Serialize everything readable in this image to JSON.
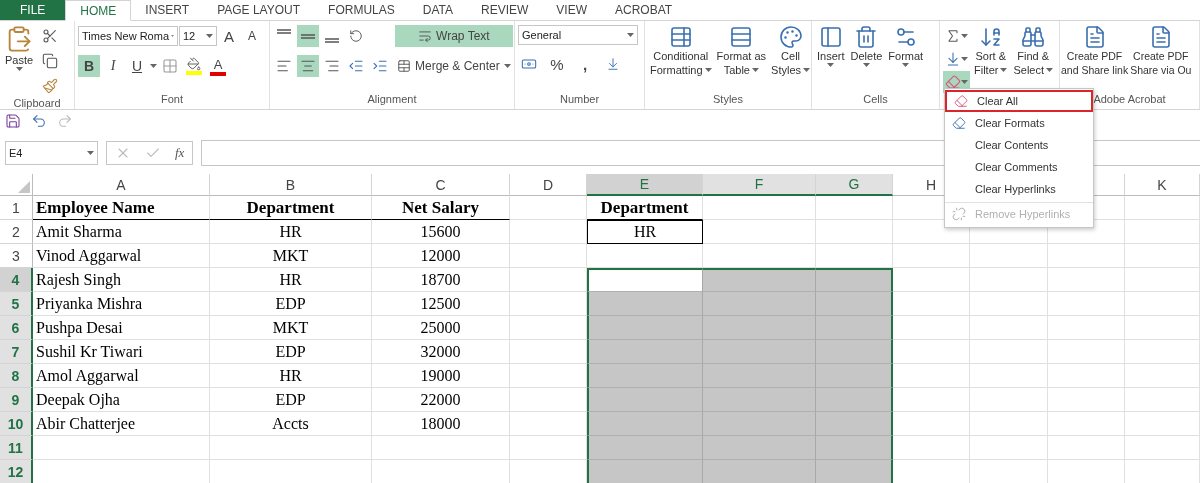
{
  "tabs": [
    {
      "label": "FILE",
      "kind": "file",
      "selected": false
    },
    {
      "label": "HOME",
      "kind": "tab",
      "selected": true
    },
    {
      "label": "INSERT",
      "kind": "tab",
      "selected": false
    },
    {
      "label": "PAGE LAYOUT",
      "kind": "tab",
      "selected": false
    },
    {
      "label": "FORMULAS",
      "kind": "tab",
      "selected": false
    },
    {
      "label": "DATA",
      "kind": "tab",
      "selected": false
    },
    {
      "label": "REVIEW",
      "kind": "tab",
      "selected": false
    },
    {
      "label": "VIEW",
      "kind": "tab",
      "selected": false
    },
    {
      "label": "ACROBAT",
      "kind": "tab",
      "selected": false
    }
  ],
  "clipboard": {
    "label": "Clipboard",
    "paste": "Paste"
  },
  "font": {
    "label": "Font",
    "font_name": "Times New Roma",
    "font_size": "12",
    "grow": "A",
    "shrink": "A",
    "bold": {
      "label": "B",
      "selected": true
    },
    "italic": {
      "label": "I",
      "selected": false
    },
    "underline": {
      "label": "U",
      "selected": false
    },
    "font_color": "A"
  },
  "alignment": {
    "label": "Alignment",
    "vertical": [
      {
        "selected": false
      },
      {
        "selected": true
      },
      {
        "selected": false
      }
    ],
    "horizontal": [
      {
        "selected": false
      },
      {
        "selected": true
      },
      {
        "selected": false
      }
    ],
    "wrap_text": {
      "label": "Wrap Text",
      "selected": true
    },
    "merge": "Merge & Center"
  },
  "number": {
    "label": "Number",
    "format": "General",
    "percent": "%",
    "comma": ","
  },
  "styles": {
    "label": "Styles",
    "buttons": [
      {
        "lines": [
          "Conditional",
          "Formatting"
        ]
      },
      {
        "lines": [
          "Format as",
          "Table"
        ]
      },
      {
        "lines": [
          "Cell",
          "Styles"
        ]
      }
    ]
  },
  "cells": {
    "label": "Cells",
    "buttons": [
      "Insert",
      "Delete",
      "Format"
    ]
  },
  "editing": {
    "clear_pressed": true,
    "buttons": [
      {
        "lines": [
          "Sort &",
          "Filter"
        ]
      },
      {
        "lines": [
          "Find &",
          "Select"
        ]
      }
    ]
  },
  "acrobat": {
    "label": "Adobe Acrobat",
    "buttons": [
      {
        "lines": [
          "Create PDF",
          "and Share link"
        ]
      },
      {
        "lines": [
          "Create PDF",
          "Share via Ou"
        ]
      }
    ]
  },
  "formula_bar": {
    "name_box": "E4",
    "function_label": "fx"
  },
  "columns": [
    {
      "label": "A",
      "selected": false,
      "active": false
    },
    {
      "label": "B",
      "selected": false,
      "active": false
    },
    {
      "label": "C",
      "selected": false,
      "active": false
    },
    {
      "label": "D",
      "selected": false,
      "active": false
    },
    {
      "label": "E",
      "selected": true,
      "active": true
    },
    {
      "label": "F",
      "selected": true,
      "active": false
    },
    {
      "label": "G",
      "selected": true,
      "active": false
    },
    {
      "label": "H",
      "selected": false,
      "active": false
    },
    {
      "label": "K",
      "selected": false,
      "active": false
    }
  ],
  "rows": [
    {
      "number": "1",
      "selected": false,
      "active": false,
      "cells": [
        {
          "text": "Employee Name",
          "kind": "heading"
        },
        {
          "text": "Department",
          "kind": "heading"
        },
        {
          "text": "Net Salary",
          "kind": "heading"
        },
        null,
        {
          "text": "Department",
          "kind": "heading"
        },
        null,
        null,
        null,
        null
      ]
    },
    {
      "number": "2",
      "selected": false,
      "active": false,
      "cells": [
        {
          "text": "Amit Sharma",
          "kind": "plain"
        },
        {
          "text": "HR",
          "kind": "plain"
        },
        {
          "text": "15600",
          "kind": "plain"
        },
        null,
        {
          "text": "HR",
          "kind": "boxed"
        },
        null,
        null,
        null,
        null
      ]
    },
    {
      "number": "3",
      "selected": false,
      "active": false,
      "cells": [
        {
          "text": "Vinod Aggarwal",
          "kind": "plain"
        },
        {
          "text": "MKT",
          "kind": "plain"
        },
        {
          "text": "12000",
          "kind": "plain"
        },
        null,
        null,
        null,
        null,
        null,
        null
      ]
    },
    {
      "number": "4",
      "selected": true,
      "active": true,
      "cells": [
        {
          "text": "Rajesh Singh",
          "kind": "plain"
        },
        {
          "text": "HR",
          "kind": "plain"
        },
        {
          "text": "18700",
          "kind": "plain"
        },
        null,
        null,
        null,
        null,
        null,
        null
      ]
    },
    {
      "number": "5",
      "selected": true,
      "active": false,
      "cells": [
        {
          "text": "Priyanka Mishra",
          "kind": "plain"
        },
        {
          "text": "EDP",
          "kind": "plain"
        },
        {
          "text": "12500",
          "kind": "plain"
        },
        null,
        null,
        null,
        null,
        null,
        null
      ]
    },
    {
      "number": "6",
      "selected": true,
      "active": false,
      "cells": [
        {
          "text": "Pushpa Desai",
          "kind": "plain"
        },
        {
          "text": "MKT",
          "kind": "plain"
        },
        {
          "text": "25000",
          "kind": "plain"
        },
        null,
        null,
        null,
        null,
        null,
        null
      ]
    },
    {
      "number": "7",
      "selected": true,
      "active": false,
      "cells": [
        {
          "text": "Sushil Kr Tiwari",
          "kind": "plain"
        },
        {
          "text": "EDP",
          "kind": "plain"
        },
        {
          "text": "32000",
          "kind": "plain"
        },
        null,
        null,
        null,
        null,
        null,
        null
      ]
    },
    {
      "number": "8",
      "selected": true,
      "active": false,
      "cells": [
        {
          "text": "Amol Aggarwal",
          "kind": "plain"
        },
        {
          "text": "HR",
          "kind": "plain"
        },
        {
          "text": "19000",
          "kind": "plain"
        },
        null,
        null,
        null,
        null,
        null,
        null
      ]
    },
    {
      "number": "9",
      "selected": true,
      "active": false,
      "cells": [
        {
          "text": "Deepak Ojha",
          "kind": "plain"
        },
        {
          "text": "EDP",
          "kind": "plain"
        },
        {
          "text": "22000",
          "kind": "plain"
        },
        null,
        null,
        null,
        null,
        null,
        null
      ]
    },
    {
      "number": "10",
      "selected": true,
      "active": false,
      "cells": [
        {
          "text": "Abir Chatterjee",
          "kind": "plain"
        },
        {
          "text": "Accts",
          "kind": "plain"
        },
        {
          "text": "18000",
          "kind": "plain"
        },
        null,
        null,
        null,
        null,
        null,
        null
      ]
    },
    {
      "number": "11",
      "selected": true,
      "active": false
    },
    {
      "number": "12",
      "selected": true,
      "active": false
    }
  ],
  "clear_menu": {
    "items": [
      {
        "label": "Clear All",
        "kind": "eraser",
        "selected": true,
        "disabled": false,
        "separator_before": false
      },
      {
        "label": "Clear Formats",
        "kind": "format-eraser",
        "selected": false,
        "disabled": false,
        "separator_before": false
      },
      {
        "label": "Clear Contents",
        "kind": "plain",
        "selected": false,
        "disabled": false,
        "separator_before": false
      },
      {
        "label": "Clear Comments",
        "kind": "plain",
        "selected": false,
        "disabled": false,
        "separator_before": false
      },
      {
        "label": "Clear Hyperlinks",
        "kind": "plain",
        "selected": false,
        "disabled": false,
        "separator_before": false
      },
      {
        "label": "Remove Hyperlinks",
        "kind": "unlink",
        "selected": false,
        "disabled": true,
        "separator_before": true
      }
    ]
  }
}
